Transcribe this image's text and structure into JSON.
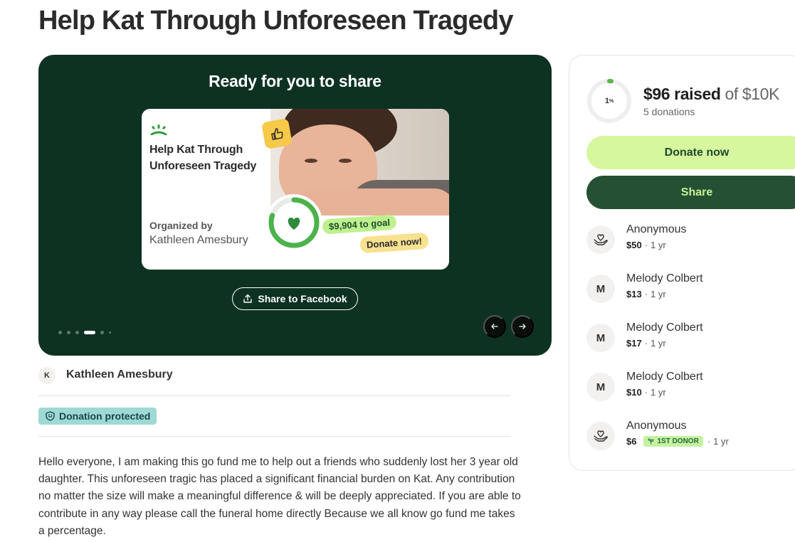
{
  "page": {
    "title": "Help Kat Through Unforeseen Tragedy"
  },
  "carousel": {
    "heading": "Ready for you to share",
    "card": {
      "title": "Help Kat Through Unforeseen Tragedy",
      "organized_by_label": "Organized by",
      "organizer": "Kathleen Amesbury",
      "to_goal": "$9,904 to goal",
      "donate_cta": "Donate now!",
      "progress_fraction": 0.01
    },
    "share_facebook_label": "Share to Facebook",
    "slides": 6,
    "active_slide": 4,
    "prev_icon": "arrow-left-icon",
    "next_icon": "arrow-right-icon"
  },
  "organizer": {
    "avatar_initial": "K",
    "name": "Kathleen Amesbury"
  },
  "protection": {
    "label": "Donation protected",
    "icon": "shield-icon"
  },
  "description": "Hello everyone, I am making this go fund me to help out a friends who suddenly lost her 3 year old daughter. This unforeseen tragic has placed a significant financial burden on Kat. Any contribution no matter the size will make a meaningful difference & will be deeply appreciated. If you are able to contribute in any way please call the funeral home directly Because we all know go fund me takes a percentage.",
  "sidebar": {
    "progress_percent": "1",
    "progress_percent_symbol": "%",
    "progress_fraction": 0.01,
    "raised": "$96 raised",
    "goal": "of $10K",
    "donations_count": "5 donations",
    "donate_label": "Donate now",
    "share_label": "Share",
    "donors": [
      {
        "name": "Anonymous",
        "amount": "$50",
        "time": "1 yr",
        "avatar": "heart-hand-icon",
        "initial": ""
      },
      {
        "name": "Melody Colbert",
        "amount": "$13",
        "time": "1 yr",
        "avatar": "initial",
        "initial": "M"
      },
      {
        "name": "Melody Colbert",
        "amount": "$17",
        "time": "1 yr",
        "avatar": "initial",
        "initial": "M"
      },
      {
        "name": "Melody Colbert",
        "amount": "$10",
        "time": "1 yr",
        "avatar": "initial",
        "initial": "M"
      },
      {
        "name": "Anonymous",
        "amount": "$6",
        "time": "1 yr",
        "avatar": "heart-hand-icon",
        "initial": "",
        "badge": "1ST DONOR"
      }
    ],
    "separator": "·"
  },
  "colors": {
    "carousel_bg": "#0d3222",
    "accent_green": "#d7f79f",
    "share_dark": "#265033",
    "progress_green": "#59b54a",
    "protected_bg": "#9fd9d6"
  }
}
